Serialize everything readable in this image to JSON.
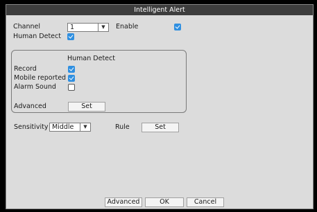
{
  "dialog": {
    "title": "Intelligent Alert"
  },
  "channel": {
    "label": "Channel",
    "value": "1"
  },
  "enable": {
    "label": "Enable",
    "checked": true
  },
  "human_detect": {
    "label": "Human Detect",
    "checked": true
  },
  "group": {
    "title": "Human Detect",
    "record": {
      "label": "Record",
      "checked": true
    },
    "mobile_reported": {
      "label": "Mobile reported",
      "checked": true
    },
    "alarm_sound": {
      "label": "Alarm Sound",
      "checked": false
    },
    "advanced": {
      "label": "Advanced",
      "button": "Set"
    }
  },
  "sensitivity": {
    "label": "Sensitivity",
    "value": "Middle"
  },
  "rule": {
    "label": "Rule",
    "button": "Set"
  },
  "footer": {
    "advanced": "Advanced",
    "ok": "OK",
    "cancel": "Cancel"
  },
  "icons": {
    "checkbox_checked": "checkmark-icon",
    "dropdown": "chevron-down-icon"
  },
  "colors": {
    "title_bar": "#3d3d3d",
    "dialog_bg": "#dcdcdc",
    "checkbox_on": "#2f8fe0"
  }
}
